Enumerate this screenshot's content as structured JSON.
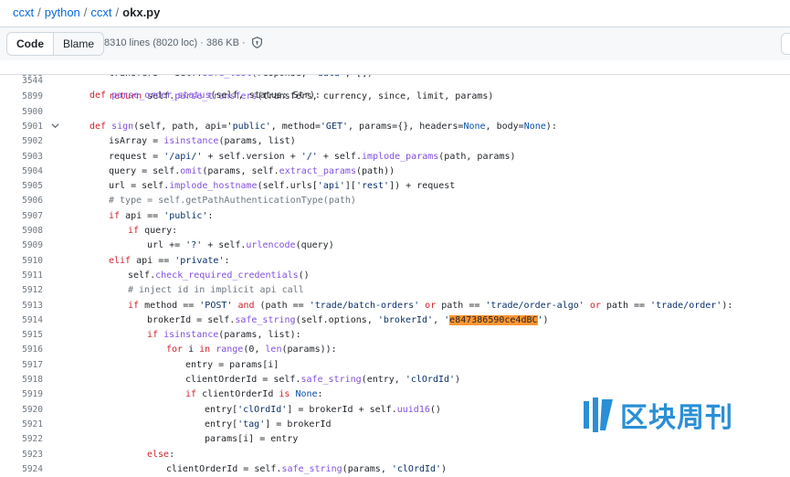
{
  "breadcrumb": {
    "items": [
      "ccxt",
      "python",
      "ccxt"
    ],
    "separator": "/",
    "file": "okx.py"
  },
  "toolbar": {
    "code_label": "Code",
    "blame_label": "Blame",
    "file_info": "8310 lines (8020 loc) · 386 KB ·",
    "shield_icon": "shield-check-icon"
  },
  "sticky": {
    "number": "3544",
    "code": "def parse_order_status(self, status: Str):"
  },
  "lines": [
    {
      "n": "5898",
      "code": "transfers = self.safe_list(response, 'data', [])"
    },
    {
      "n": "5899",
      "code": "return self.parse_transfers(transfers, currency, since, limit, params)"
    },
    {
      "n": "5900",
      "code": ""
    },
    {
      "n": "5901",
      "code": "def sign(self, path, api='public', method='GET', params={}, headers=None, body=None):"
    },
    {
      "n": "5902",
      "code": "isArray = isinstance(params, list)"
    },
    {
      "n": "5903",
      "code": "request = '/api/' + self.version + '/' + self.implode_params(path, params)"
    },
    {
      "n": "5904",
      "code": "query = self.omit(params, self.extract_params(path))"
    },
    {
      "n": "5905",
      "code": "url = self.implode_hostname(self.urls['api']['rest']) + request"
    },
    {
      "n": "5906",
      "code": "# type = self.getPathAuthenticationType(path)"
    },
    {
      "n": "5907",
      "code": "if api == 'public':"
    },
    {
      "n": "5908",
      "code": "if query:"
    },
    {
      "n": "5909",
      "code": "url += '?' + self.urlencode(query)"
    },
    {
      "n": "5910",
      "code": "elif api == 'private':"
    },
    {
      "n": "5911",
      "code": "self.check_required_credentials()"
    },
    {
      "n": "5912",
      "code": "# inject id in implicit api call"
    },
    {
      "n": "5913",
      "code": "if method == 'POST' and (path == 'trade/batch-orders' or path == 'trade/order-algo' or path == 'trade/order'):"
    },
    {
      "n": "5914",
      "code": "brokerId = self.safe_string(self.options, 'brokerId', 'e847386590ce4dBC')"
    },
    {
      "n": "5915",
      "code": "if isinstance(params, list):"
    },
    {
      "n": "5916",
      "code": "for i in range(0, len(params)):"
    },
    {
      "n": "5917",
      "code": "entry = params[i]"
    },
    {
      "n": "5918",
      "code": "clientOrderId = self.safe_string(entry, 'clOrdId')"
    },
    {
      "n": "5919",
      "code": "if clientOrderId is None:"
    },
    {
      "n": "5920",
      "code": "entry['clOrdId'] = brokerId + self.uuid16()"
    },
    {
      "n": "5921",
      "code": "entry['tag'] = brokerId"
    },
    {
      "n": "5922",
      "code": "params[i] = entry"
    },
    {
      "n": "5923",
      "code": "else:"
    },
    {
      "n": "5924",
      "code": "clientOrderId = self.safe_string(params, 'clOrdId')"
    }
  ],
  "watermark": {
    "text": "区块周刊"
  }
}
